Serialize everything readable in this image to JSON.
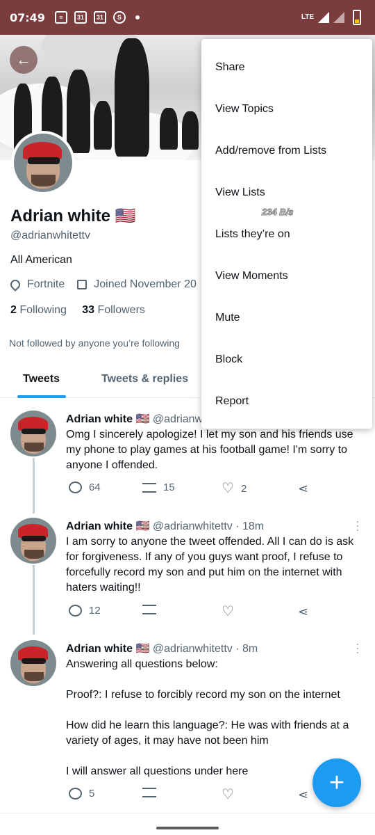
{
  "status_bar": {
    "time": "07:49",
    "network": "LTE",
    "icons": [
      "news-icon",
      "calendar-31-icon",
      "calendar-31-icon",
      "shazam-icon",
      "dot-icon"
    ],
    "cal1": "31",
    "cal2": "31"
  },
  "profile": {
    "name": "Adrian white 🇺🇸",
    "handle": "@adrianwhitettv",
    "bio": "All American",
    "location": "Fortnite",
    "joined": "Joined November 20",
    "following_count": "2",
    "following_label": "Following",
    "followers_count": "33",
    "followers_label": "Followers",
    "not_followed": "Not followed by anyone you’re following"
  },
  "tabs": [
    {
      "label": "Tweets"
    },
    {
      "label": "Tweets & replies"
    }
  ],
  "menu": {
    "items": [
      {
        "label": "Share"
      },
      {
        "label": "View Topics"
      },
      {
        "label": "Add/remove from Lists"
      },
      {
        "label": "View Lists"
      },
      {
        "label": "Lists they’re on"
      },
      {
        "label": "View Moments"
      },
      {
        "label": "Mute"
      },
      {
        "label": "Block"
      },
      {
        "label": "Report"
      }
    ],
    "speed_overlay": "234 B/s"
  },
  "tweets": [
    {
      "author": "Adrian white 🇺🇸",
      "handle_time": "@adrianw",
      "text": [
        "Omg I sincerely apologize! I let my son and his friends use my phone to play games at his football game! I'm sorry to anyone I offended."
      ],
      "replies": "64",
      "retweets": "15",
      "likes": "2"
    },
    {
      "author": "Adrian white 🇺🇸",
      "handle_time": "@adrianwhitettv · 18m",
      "text": [
        "I am sorry to anyone the tweet offended. All I can do is ask for forgiveness. If any of you guys want proof, I refuse to forcefully record my son and put him on the internet with haters waiting!!"
      ],
      "replies": "12",
      "retweets": "",
      "likes": ""
    },
    {
      "author": "Adrian white 🇺🇸",
      "handle_time": "@adrianwhitettv · 8m",
      "text": [
        "Answering all questions below:",
        "Proof?: I refuse to forcibly record my son on the internet",
        "How did he learn this language?: He was with friends at a variety of ages, it may have not been him",
        "I will answer all questions under here"
      ],
      "replies": "5",
      "retweets": "",
      "likes": ""
    }
  ],
  "fab": {
    "label": "+"
  },
  "colors": {
    "accent": "#1d9bf0",
    "status_bar": "#7a3c3c",
    "secondary_text": "#536471"
  }
}
